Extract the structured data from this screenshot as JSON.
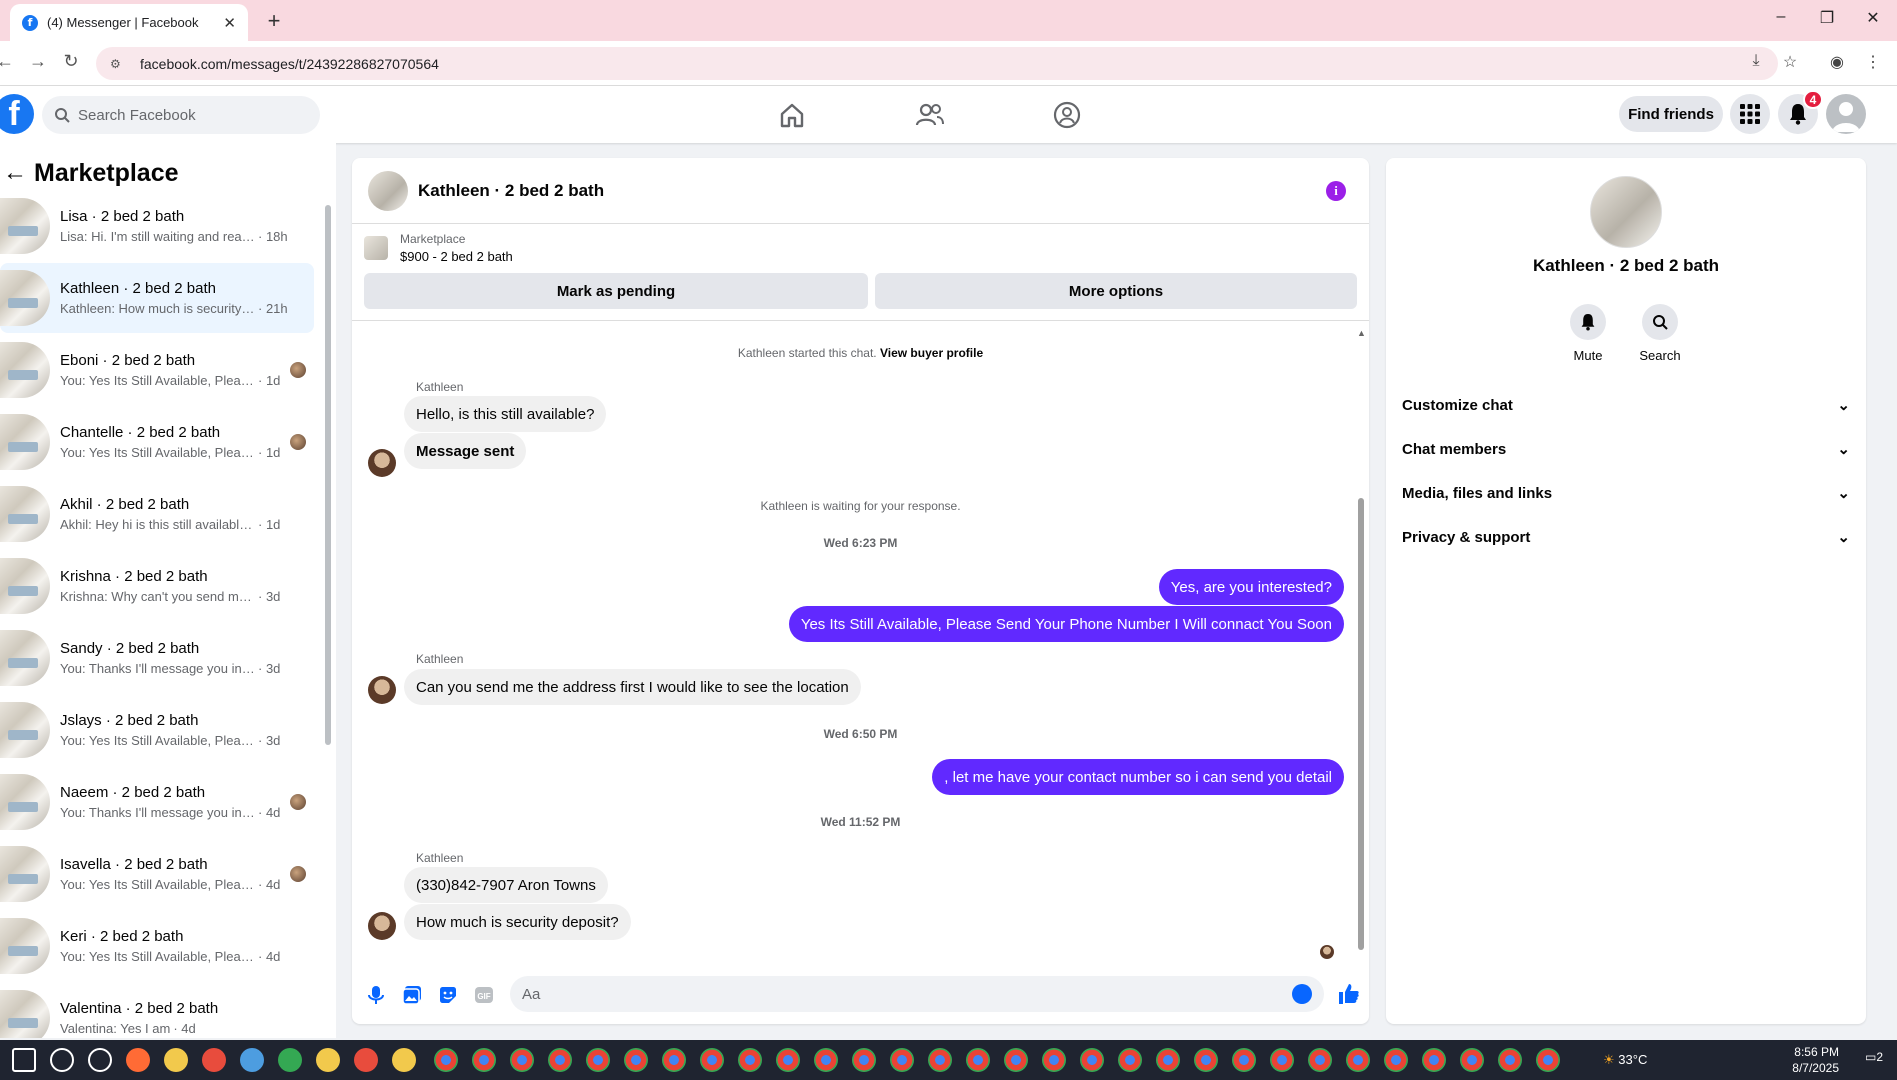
{
  "browser": {
    "tab_title": "(4) Messenger | Facebook",
    "url": "facebook.com/messages/t/24392286827070564"
  },
  "fb": {
    "search_placeholder": "Search Facebook",
    "find_friends": "Find friends",
    "notif_count": "4"
  },
  "sidebar": {
    "title": "Marketplace",
    "conversations": [
      {
        "name": "Lisa · 2 bed 2 bath",
        "preview": "Lisa: Hi. I'm still waiting and really ...",
        "time": "· 18h",
        "active": false
      },
      {
        "name": "Kathleen · 2 bed 2 bath",
        "preview": "Kathleen: How much is security d...",
        "time": "· 21h",
        "active": true
      },
      {
        "name": "Eboni · 2 bed 2 bath",
        "preview": "You: Yes Its Still Available, Please...",
        "time": "· 1d",
        "active": false
      },
      {
        "name": "Chantelle · 2 bed 2 bath",
        "preview": "You: Yes Its Still Available, Please...",
        "time": "· 1d",
        "active": false
      },
      {
        "name": "Akhil · 2 bed 2 bath",
        "preview": "Akhil: Hey hi is this still available ?",
        "time": "· 1d",
        "active": false
      },
      {
        "name": "Krishna · 2 bed 2 bath",
        "preview": "Krishna: Why can't you send me yo...",
        "time": "· 3d",
        "active": false
      },
      {
        "name": "Sandy · 2 bed 2 bath",
        "preview": "You: Thanks I'll message you in a m...",
        "time": "· 3d",
        "active": false
      },
      {
        "name": "Jslays · 2 bed 2 bath",
        "preview": "You: Yes Its Still Available, Please Se...",
        "time": "· 3d",
        "active": false
      },
      {
        "name": "Naeem · 2 bed 2 bath",
        "preview": "You: Thanks I'll message you in ...",
        "time": "· 4d",
        "active": false
      },
      {
        "name": "Isavella · 2 bed 2 bath",
        "preview": "You: Yes Its Still Available, Please...",
        "time": "· 4d",
        "active": false
      },
      {
        "name": "Keri · 2 bed 2 bath",
        "preview": "You: Yes Its Still Available, Please Se...",
        "time": "· 4d",
        "active": false
      },
      {
        "name": "Valentina · 2 bed 2 bath",
        "preview": "Valentina: Yes I am",
        "time": "· 4d",
        "active": false
      }
    ]
  },
  "chat": {
    "title": "Kathleen · 2 bed 2 bath",
    "listing_source": "Marketplace",
    "listing_price": "$900 - 2 bed 2 bath",
    "mark_pending": "Mark as pending",
    "more_options": "More options",
    "started_text": "Kathleen started this chat.",
    "view_profile": "View buyer profile",
    "sender": "Kathleen",
    "msg1": "Hello, is this still available?",
    "msg2": "Message sent",
    "waiting": "Kathleen is waiting for your response.",
    "ts1": "Wed 6:23 PM",
    "out1": "Yes, are you interested?",
    "out2": "Yes Its Still Available, Please Send Your Phone Number I Will connact You Soon",
    "msg3": "Can you send me the address first I would like to see the location",
    "ts2": "Wed 6:50 PM",
    "out3": ", let me have your contact number so i can send you detail",
    "ts3": "Wed 11:52 PM",
    "msg4": "(330)842-7907 Aron Towns",
    "msg5": "How much is security deposit?",
    "input_placeholder": "Aa"
  },
  "panel": {
    "name": "Kathleen · 2 bed 2 bath",
    "mute": "Mute",
    "search": "Search",
    "rows": [
      "Customize chat",
      "Chat members",
      "Media, files and links",
      "Privacy & support"
    ]
  },
  "taskbar": {
    "temp": "33°C",
    "time": "8:56 PM",
    "date": "8/7/2025",
    "notif": "2"
  }
}
